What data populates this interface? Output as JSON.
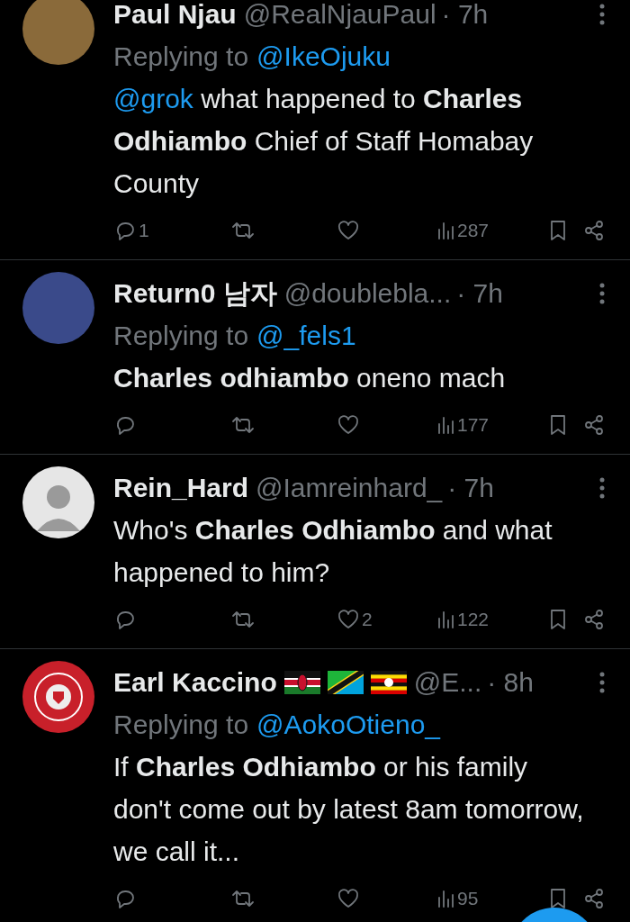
{
  "tweets": [
    {
      "avatar": {
        "kind": "photo",
        "color": "#8a6a3a"
      },
      "name": "Paul Njau",
      "handle": "@RealNjauPaul",
      "time": "· 7h",
      "reply": {
        "label": "Replying to",
        "handle": "@IkeOjuku"
      },
      "body": [
        {
          "kind": "mention",
          "text": "@grok"
        },
        {
          "kind": "text",
          "text": "what happened to **Charles Odhiambo** Chief of Staff Homabay County"
        }
      ],
      "replies": "1",
      "views": "287"
    },
    {
      "avatar": {
        "kind": "photo",
        "color": "#3a4a8a"
      },
      "name": "Return0 남자",
      "handle": "@doublebla...",
      "time": "· 7h",
      "reply": {
        "label": "Replying to",
        "handle": "@_fels1"
      },
      "body": [
        {
          "kind": "text",
          "text": "**Charles odhiambo** oneno mach"
        }
      ],
      "views": "177"
    },
    {
      "avatar": {
        "kind": "silhouette",
        "color": "#e6e6e6"
      },
      "name": "Rein_Hard",
      "handle": "@Iamreinhard_",
      "time": "· 7h",
      "body": [
        {
          "kind": "text",
          "text": "Who's **Charles Odhiambo** and what happened to him?"
        }
      ],
      "likes": "2",
      "views": "122"
    },
    {
      "avatar": {
        "kind": "logo",
        "color": "#c8202a"
      },
      "name": "Earl Kaccino",
      "flags": [
        {
          "kind": "kenya"
        },
        {
          "kind": "tanzania"
        },
        {
          "kind": "uganda"
        }
      ],
      "handle": "@E...",
      "time": "· 8h",
      "reply": {
        "label": "Replying to",
        "handle": "@AokoOtieno_"
      },
      "body": [
        {
          "kind": "text",
          "text": "If **Charles Odhiambo** or his family don't come out by latest 8am tomorrow, we call it..."
        }
      ],
      "views": "95"
    }
  ]
}
